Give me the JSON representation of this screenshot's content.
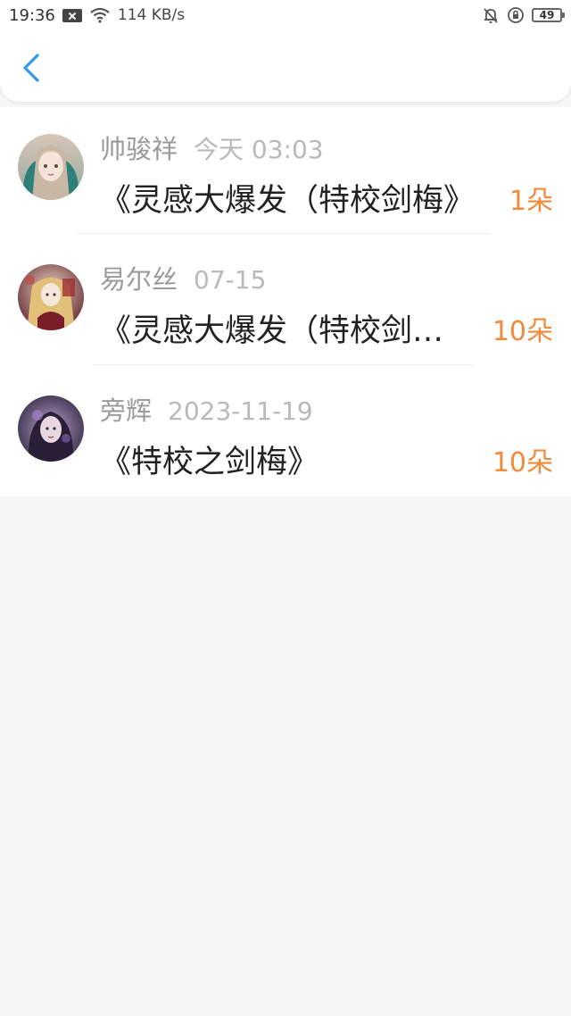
{
  "status_bar": {
    "time": "19:36",
    "net_speed": "114 KB/s",
    "battery": "49",
    "icons": [
      "sim-off-icon",
      "wifi-icon",
      "alarm-off-icon",
      "rotation-lock-icon",
      "battery-icon"
    ]
  },
  "nav": {
    "back_icon": "chevron-left-icon",
    "accent_color": "#2f9bea"
  },
  "items": [
    {
      "name": "帅骏祥",
      "time": "今天 03:03",
      "title": "《灵感大爆发（特校剑梅》",
      "count": "1朵"
    },
    {
      "name": "易尔丝",
      "time": "07-15",
      "title": "《灵感大爆发（特校剑梅》",
      "count": "10朵"
    },
    {
      "name": "旁辉",
      "time": "2023-11-19",
      "title": "《特校之剑梅》",
      "count": "10朵"
    }
  ],
  "colors": {
    "count": "#f08a3c",
    "name": "#9a9a9a",
    "title": "#222222",
    "page_bg": "#f7f5f6"
  }
}
